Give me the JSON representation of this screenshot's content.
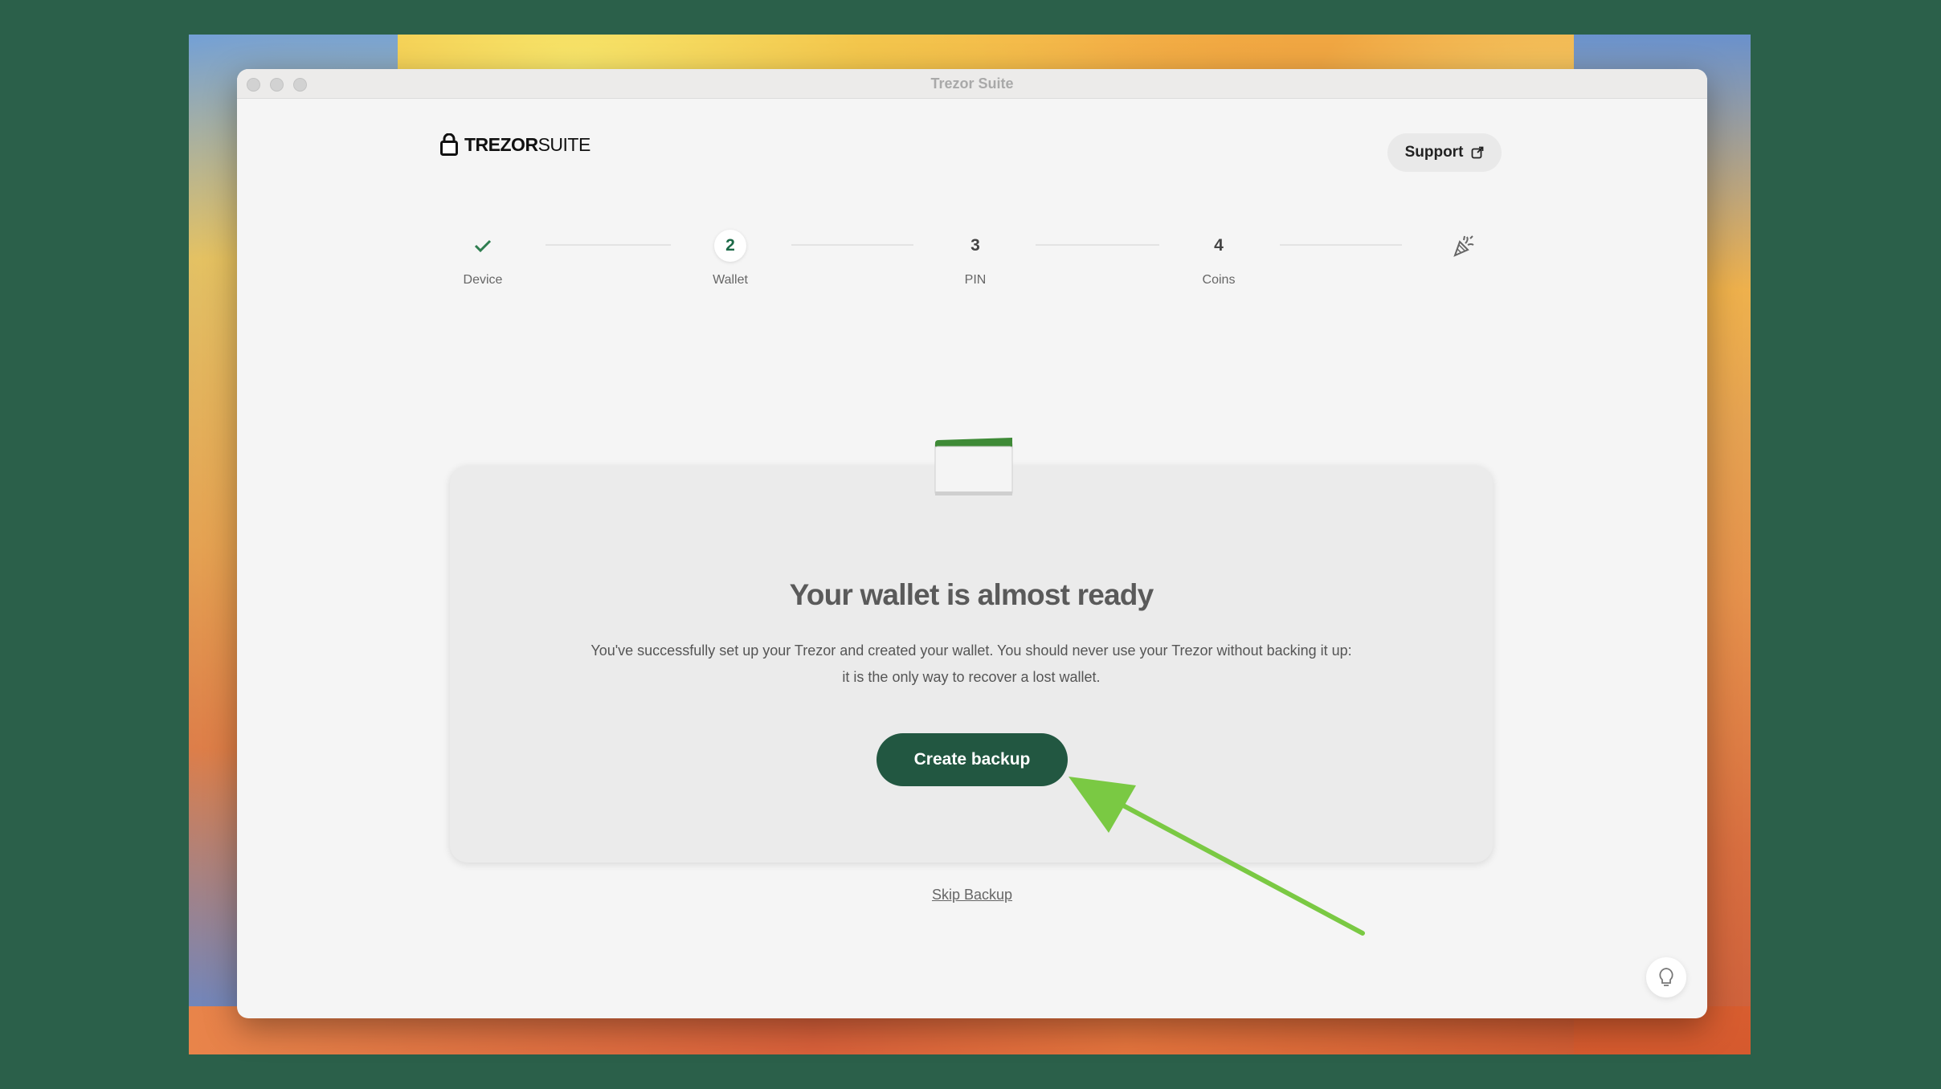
{
  "window": {
    "title": "Trezor Suite"
  },
  "header": {
    "logo_bold": "TREZOR",
    "logo_light": "SUITE",
    "support_label": "Support"
  },
  "stepper": {
    "steps": [
      {
        "label": "Device",
        "number": "",
        "state": "done"
      },
      {
        "label": "Wallet",
        "number": "2",
        "state": "active"
      },
      {
        "label": "PIN",
        "number": "3",
        "state": "pending"
      },
      {
        "label": "Coins",
        "number": "4",
        "state": "pending"
      }
    ],
    "final_icon": "party-popper-icon"
  },
  "main": {
    "heading": "Your wallet is almost ready",
    "description_line1": "You've successfully set up your Trezor and created your wallet. You should never use your Trezor without backing it up:",
    "description_line2": "it is the only way to recover a lost wallet.",
    "create_backup_label": "Create backup",
    "skip_backup_label": "Skip Backup"
  },
  "colors": {
    "brand_green": "#225741",
    "accent_arrow": "#7ac943",
    "background": "#2b604a"
  }
}
